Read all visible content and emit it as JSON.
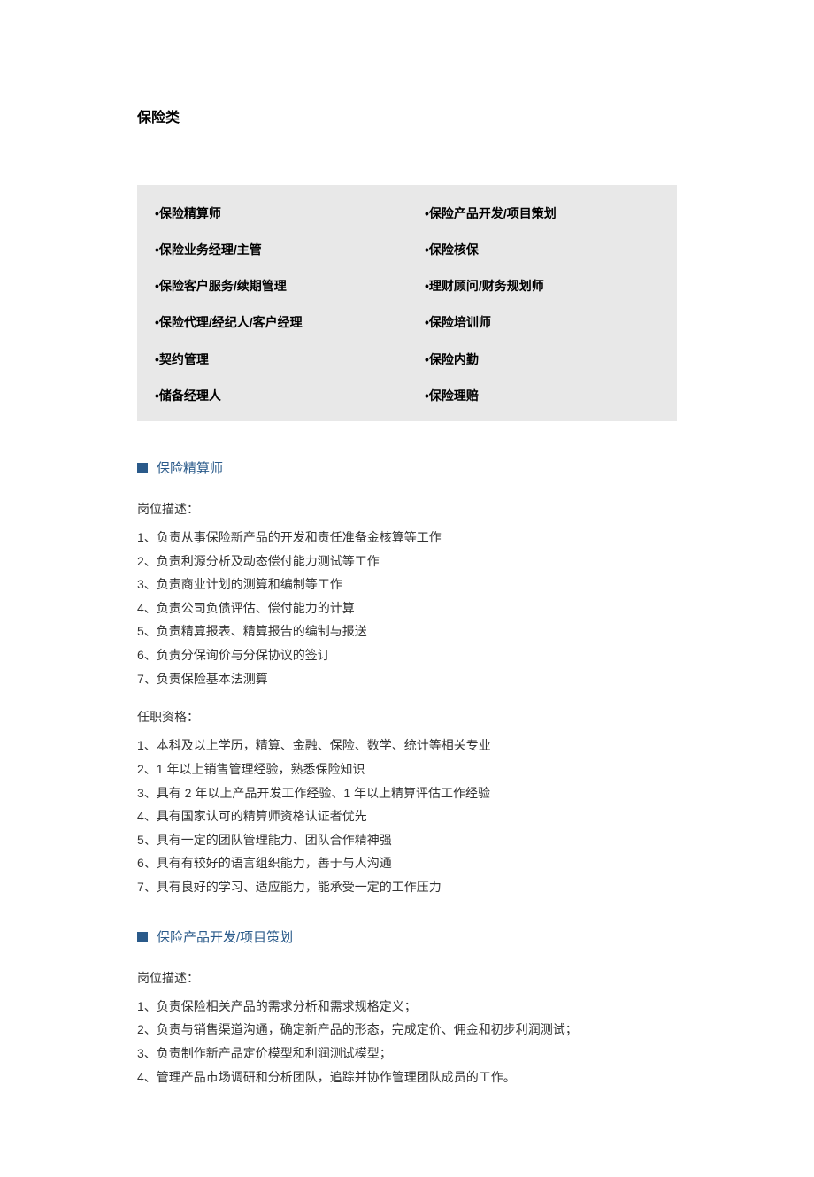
{
  "title": "保险类",
  "categories": [
    {
      "left": "•保险精算师",
      "right": "•保险产品开发/项目策划"
    },
    {
      "left": "•保险业务经理/主管",
      "right": "•保险核保"
    },
    {
      "left": "•保险客户服务/续期管理",
      "right": "•理财顾问/财务规划师"
    },
    {
      "left": "•保险代理/经纪人/客户经理",
      "right": "•保险培训师"
    },
    {
      "left": "•契约管理",
      "right": "•保险内勤"
    },
    {
      "left": "•储备经理人",
      "right": "•保险理赔"
    }
  ],
  "section1": {
    "heading": "保险精算师",
    "desc_label": "岗位描述：",
    "desc_items": [
      "1、负责从事保险新产品的开发和责任准备金核算等工作",
      "2、负责利源分析及动态偿付能力测试等工作",
      "3、负责商业计划的测算和编制等工作",
      "4、负责公司负债评估、偿付能力的计算",
      "5、负责精算报表、精算报告的编制与报送",
      "6、负责分保询价与分保协议的签订",
      "7、负责保险基本法测算"
    ],
    "qual_label": "任职资格：",
    "qual_items": [
      "1、本科及以上学历，精算、金融、保险、数学、统计等相关专业",
      "2、1 年以上销售管理经验，熟悉保险知识",
      "3、具有 2 年以上产品开发工作经验、1 年以上精算评估工作经验",
      "4、具有国家认可的精算师资格认证者优先",
      "5、具有一定的团队管理能力、团队合作精神强",
      "6、具有有较好的语言组织能力，善于与人沟通",
      "7、具有良好的学习、适应能力，能承受一定的工作压力"
    ]
  },
  "section2": {
    "heading": "保险产品开发/项目策划",
    "desc_label": "岗位描述：",
    "desc_items": [
      "1、负责保险相关产品的需求分析和需求规格定义；",
      "2、负责与销售渠道沟通，确定新产品的形态，完成定价、佣金和初步利润测试；",
      "3、负责制作新产品定价模型和利润测试模型；",
      "4、管理产品市场调研和分析团队，追踪并协作管理团队成员的工作。"
    ]
  }
}
